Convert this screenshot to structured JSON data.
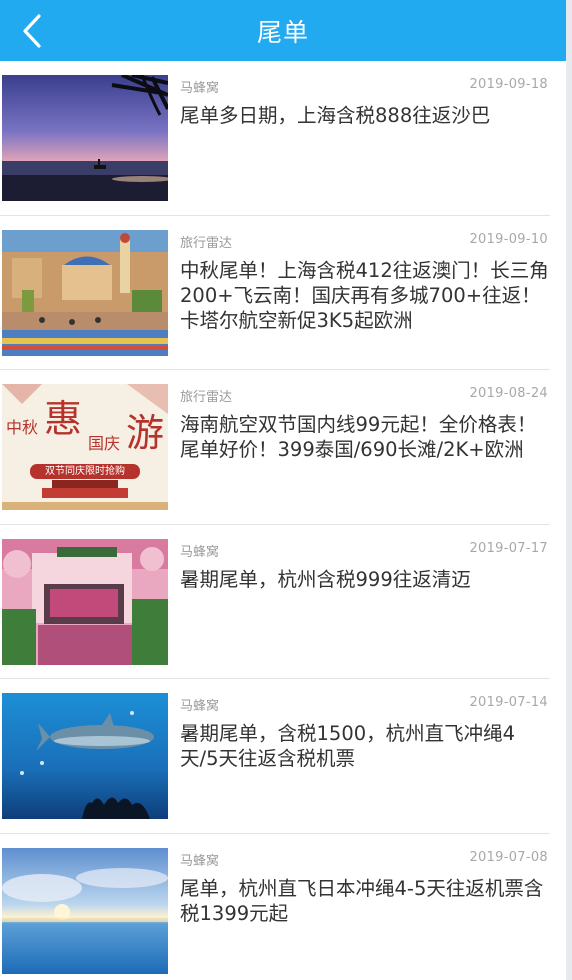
{
  "header": {
    "title": "尾单",
    "back_icon": "chevron-left-icon",
    "background_color": "#22aaf0"
  },
  "items": [
    {
      "source": "马蜂窝",
      "date": "2019-09-18",
      "headline": "尾单多日期，上海含税888往返沙巴",
      "thumb": "beach-sunset"
    },
    {
      "source": "旅行雷达",
      "date": "2019-09-10",
      "headline": "中秋尾单！上海含税412往返澳门！长三角200+飞云南！国庆再有多城700+往返！卡塔尔航空新促3K5起欧洲",
      "thumb": "park-guell"
    },
    {
      "source": "旅行雷达",
      "date": "2019-08-24",
      "headline": "海南航空双节国内线99元起！全价格表！尾单好价！399泰国/690长滩/2K+欧洲",
      "thumb": "festival-banner",
      "banner": {
        "left": "中秋",
        "big1": "惠",
        "right": "国庆",
        "big2": "游",
        "tag": "双节同庆限时抢购"
      }
    },
    {
      "source": "马蜂窝",
      "date": "2019-07-17",
      "headline": "暑期尾单，杭州含税999往返清迈",
      "thumb": "pink-cafe"
    },
    {
      "source": "马蜂窝",
      "date": "2019-07-14",
      "headline": "暑期尾单，含税1500，杭州直飞冲绳4天/5天往返含税机票",
      "thumb": "aquarium-shark"
    },
    {
      "source": "马蜂窝",
      "date": "2019-07-08",
      "headline": "尾单，杭州直飞日本冲绳4-5天往返机票含税1399元起",
      "thumb": "ocean-sky"
    }
  ]
}
